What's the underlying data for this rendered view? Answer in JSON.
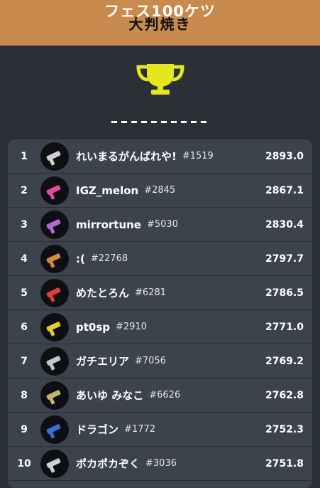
{
  "header": {
    "title": "大判焼き"
  },
  "hero": {
    "title": "フェス100ケツ",
    "icon": "trophy-icon",
    "trophy_color": "#e6e61e"
  },
  "colors": {
    "topbar": "#c98a4e",
    "background": "#2b2f36",
    "board": "#3d434c"
  },
  "leaderboard": [
    {
      "rank": "1",
      "name": "れいまるがんばれや!",
      "tag": "#1519",
      "score": "2893.0",
      "weapon_icon": "weapon-icon",
      "weapon_color": "#cfcfcf"
    },
    {
      "rank": "2",
      "name": "IGZ_melon",
      "tag": "#2845",
      "score": "2867.1",
      "weapon_icon": "weapon-icon",
      "weapon_color": "#e04aa0"
    },
    {
      "rank": "3",
      "name": "mirrortune",
      "tag": "#5030",
      "score": "2830.4",
      "weapon_icon": "weapon-icon",
      "weapon_color": "#b46ad6"
    },
    {
      "rank": "4",
      "name": ":(",
      "tag": "#22768",
      "score": "2797.7",
      "weapon_icon": "weapon-icon",
      "weapon_color": "#d58a38"
    },
    {
      "rank": "5",
      "name": "めたとろん",
      "tag": "#6281",
      "score": "2786.5",
      "weapon_icon": "weapon-icon",
      "weapon_color": "#e23c3c"
    },
    {
      "rank": "6",
      "name": "pt0sp",
      "tag": "#2910",
      "score": "2771.0",
      "weapon_icon": "weapon-icon",
      "weapon_color": "#e6c93a"
    },
    {
      "rank": "7",
      "name": "ガチエリア",
      "tag": "#7056",
      "score": "2769.2",
      "weapon_icon": "weapon-icon",
      "weapon_color": "#bfc6d1"
    },
    {
      "rank": "8",
      "name": "あいゆ みなこ",
      "tag": "#6626",
      "score": "2762.8",
      "weapon_icon": "weapon-icon",
      "weapon_color": "#c7b36a"
    },
    {
      "rank": "9",
      "name": "ドラゴン",
      "tag": "#1772",
      "score": "2752.3",
      "weapon_icon": "weapon-icon",
      "weapon_color": "#3b6fd8"
    },
    {
      "rank": "10",
      "name": "ポカポカぞく",
      "tag": "#3036",
      "score": "2751.8",
      "weapon_icon": "weapon-icon",
      "weapon_color": "#cfcfcf"
    }
  ]
}
